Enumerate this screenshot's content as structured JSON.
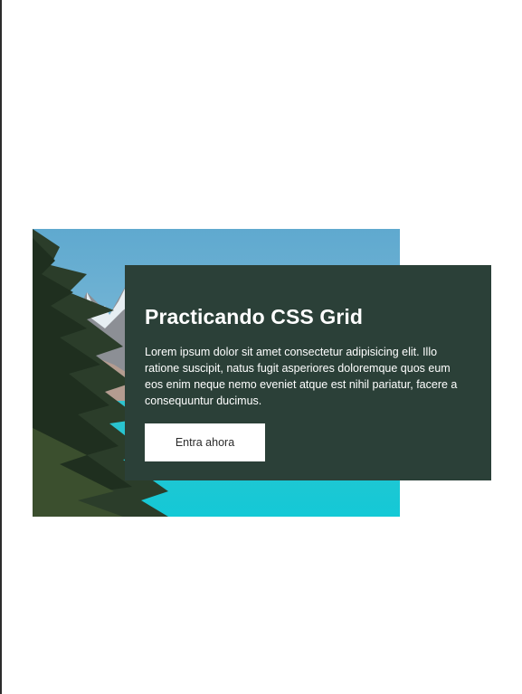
{
  "card": {
    "title": "Practicando CSS Grid",
    "body": "Lorem ipsum dolor sit amet consectetur adipisicing elit. Illo ratione suscipit, natus fugit asperiores doloremque quos eum eos enim neque nemo eveniet atque est nihil pariatur, facere a consequuntur ducimus.",
    "button_label": "Entra ahora"
  },
  "colors": {
    "card_background": "#2b4038",
    "button_background": "#ffffff",
    "lake": "#1ad0d8"
  },
  "image": {
    "subject": "lake-mountains-pine-photo"
  }
}
